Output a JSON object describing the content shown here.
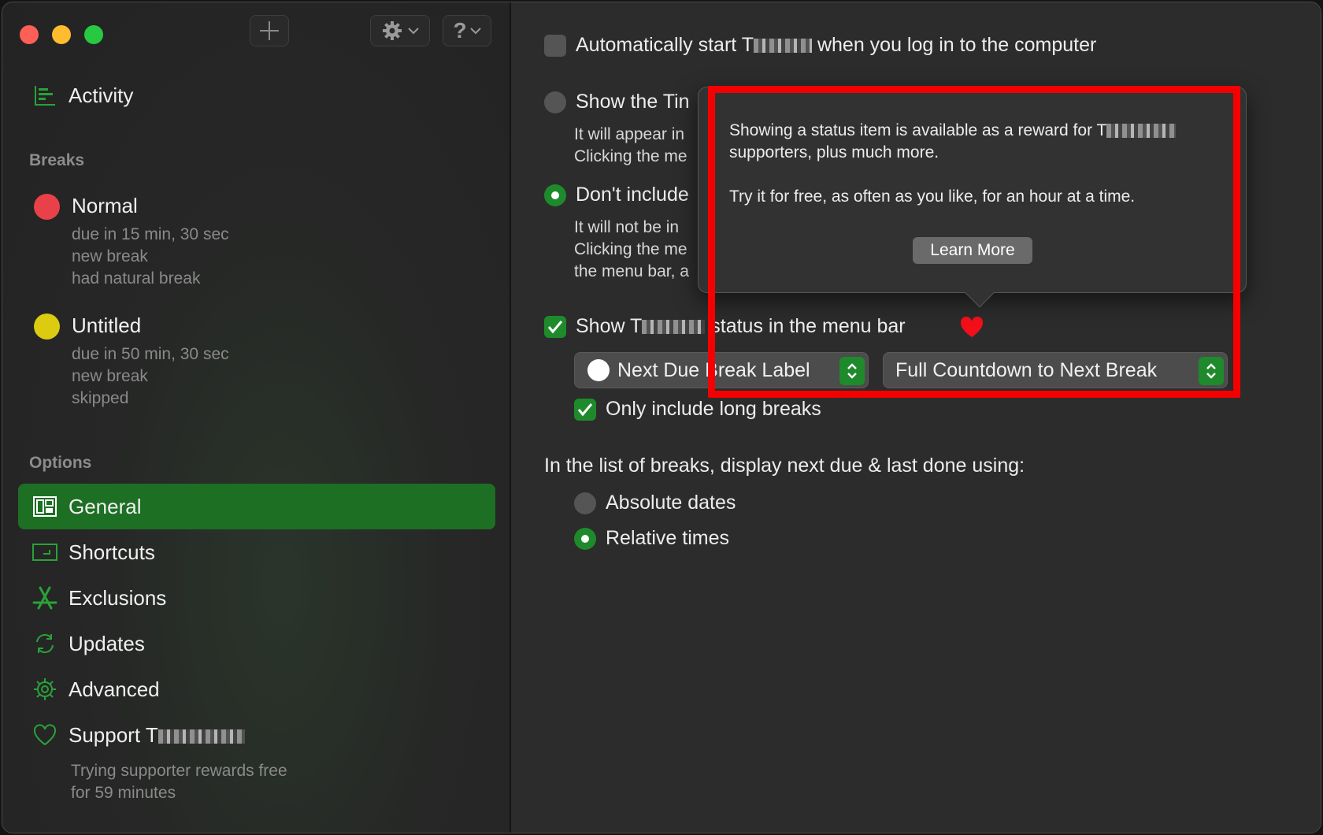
{
  "sidebar": {
    "activity_label": "Activity",
    "breaks_title": "Breaks",
    "breaks": [
      {
        "name": "Normal",
        "color": "#e8414a",
        "lines": [
          "due in 15 min, 30 sec",
          "new break",
          "had natural break"
        ]
      },
      {
        "name": "Untitled",
        "color": "#dccb11",
        "lines": [
          "due in 50 min, 30 sec",
          "new break",
          "skipped"
        ]
      }
    ],
    "options_title": "Options",
    "options": [
      {
        "label": "General",
        "icon": "general-icon"
      },
      {
        "label": "Shortcuts",
        "icon": "keyboard-icon"
      },
      {
        "label": "Exclusions",
        "icon": "app-store-icon"
      },
      {
        "label": "Updates",
        "icon": "refresh-icon"
      },
      {
        "label": "Advanced",
        "icon": "gear-icon"
      },
      {
        "label": "Support T",
        "icon": "heart-outline-icon"
      }
    ],
    "support_subtitle": [
      "Trying supporter rewards free",
      "for 59 minutes"
    ]
  },
  "main": {
    "auto_start": {
      "prefix": "Automatically start T",
      "suffix": " when you log in to the computer"
    },
    "show_timer_label": "Show the Tin",
    "show_timer_desc": [
      "It will appear in",
      "Clicking the me"
    ],
    "dont_include_label": "Don't include",
    "dont_include_desc": [
      "It will not be in",
      "Clicking the me",
      "the menu bar, a"
    ],
    "status_menu": {
      "prefix": "Show T",
      "suffix": " status in the menu bar"
    },
    "popup_label": "Next Due Break Label",
    "popup_countdown": "Full Countdown to Next Break",
    "only_long": "Only include long breaks",
    "list_display_title": "In the list of breaks, display next due & last done using:",
    "absolute_dates": "Absolute dates",
    "relative_times": "Relative times"
  },
  "popover": {
    "line1": "Showing a status item is available as a reward for T",
    "line2": "supporters, plus much more.",
    "line3": "Try it for free, as often as you like, for an hour at a time.",
    "learn_more": "Learn More"
  },
  "colors": {
    "accent": "#1e8a2c",
    "highlight": "#f40000",
    "heart": "#f30f1a"
  }
}
